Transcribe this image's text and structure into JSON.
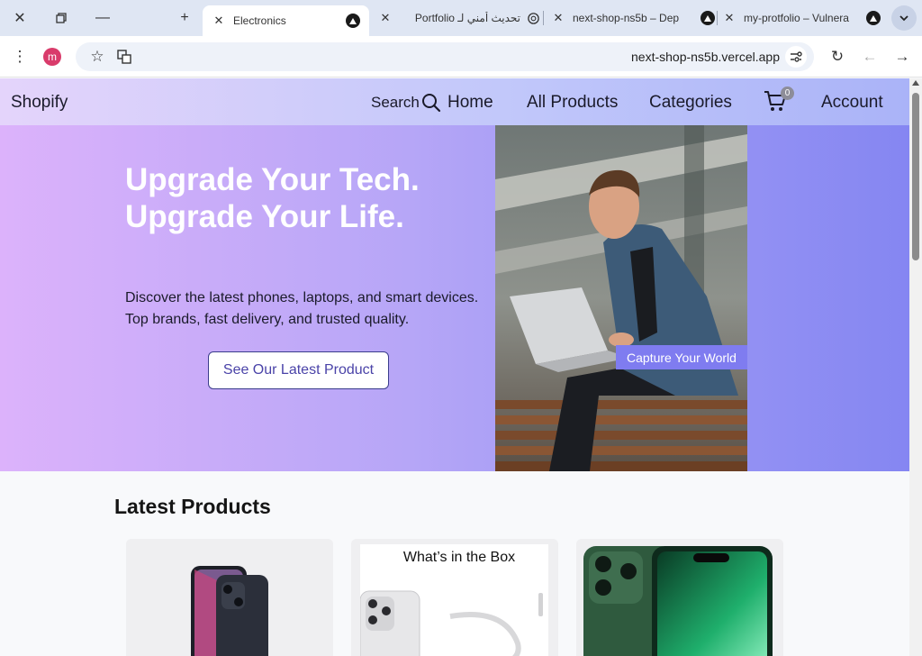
{
  "browser": {
    "tabs": [
      {
        "title": "Electronics",
        "active": true
      },
      {
        "title": "تحديث أمني لـ Portfolio",
        "active": false
      },
      {
        "title": "next-shop-ns5b – Dep",
        "active": false
      },
      {
        "title": "my-protfolio – Vulnera",
        "active": false
      }
    ],
    "profile_initial": "m",
    "url": "next-shop-ns5b.vercel.app"
  },
  "nav": {
    "brand": "Shopify",
    "search_label": "Search",
    "links": [
      "Home",
      "All Products",
      "Categories"
    ],
    "cart_count": "0",
    "account_label": "Account"
  },
  "hero": {
    "title_line1": "Upgrade Your Tech.",
    "title_line2": "Upgrade Your Life.",
    "subtitle": "Discover the latest phones, laptops, and smart devices. Top brands, fast delivery, and trusted quality.",
    "cta_label": "See Our Latest Product",
    "image_caption": "Capture Your World"
  },
  "latest": {
    "title": "Latest Products",
    "box_caption": "What’s in the Box"
  },
  "colors": {
    "accent": "#7f7cf0",
    "hero_start": "#dcb2fb",
    "hero_end": "#8586f2",
    "cta_text": "#4a43a8"
  }
}
